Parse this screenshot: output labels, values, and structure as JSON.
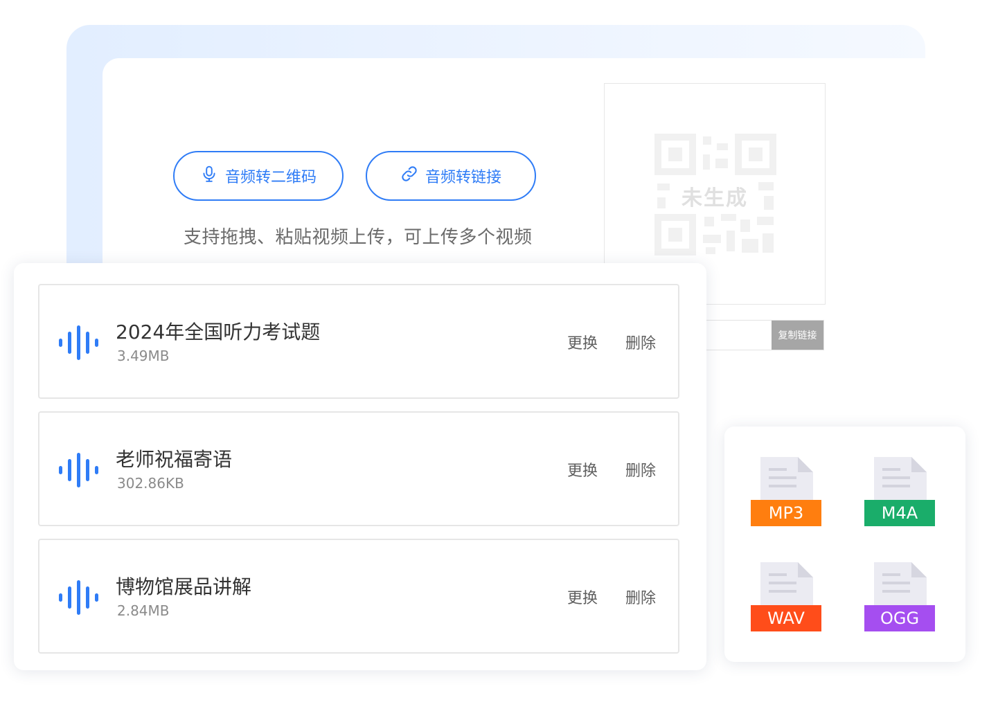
{
  "buttons": {
    "audio_to_qr": "音频转二维码",
    "audio_to_link": "音频转链接"
  },
  "upload_hint": "支持拖拽、粘贴视频上传，可上传多个视频",
  "qr_panel": {
    "placeholder_label": "未生成",
    "copy_button": "复制链接"
  },
  "files": [
    {
      "name": "2024年全国听力考试题",
      "size": "3.49MB",
      "replace": "更换",
      "delete": "删除"
    },
    {
      "name": "老师祝福寄语",
      "size": "302.86KB",
      "replace": "更换",
      "delete": "删除"
    },
    {
      "name": "博物馆展品讲解",
      "size": "2.84MB",
      "replace": "更换",
      "delete": "删除"
    }
  ],
  "formats": [
    {
      "label": "MP3",
      "color": "#ff7e0f"
    },
    {
      "label": "M4A",
      "color": "#1aad6a"
    },
    {
      "label": "WAV",
      "color": "#ff4d1a"
    },
    {
      "label": "OGG",
      "color": "#a54ef0"
    }
  ],
  "colors": {
    "accent": "#2f7cf6",
    "wave": "#2f7cf6"
  },
  "icons": {
    "audio_to_qr": "microphone-icon",
    "audio_to_link": "link-icon",
    "file": "audio-wave-icon",
    "format": "document-icon"
  }
}
